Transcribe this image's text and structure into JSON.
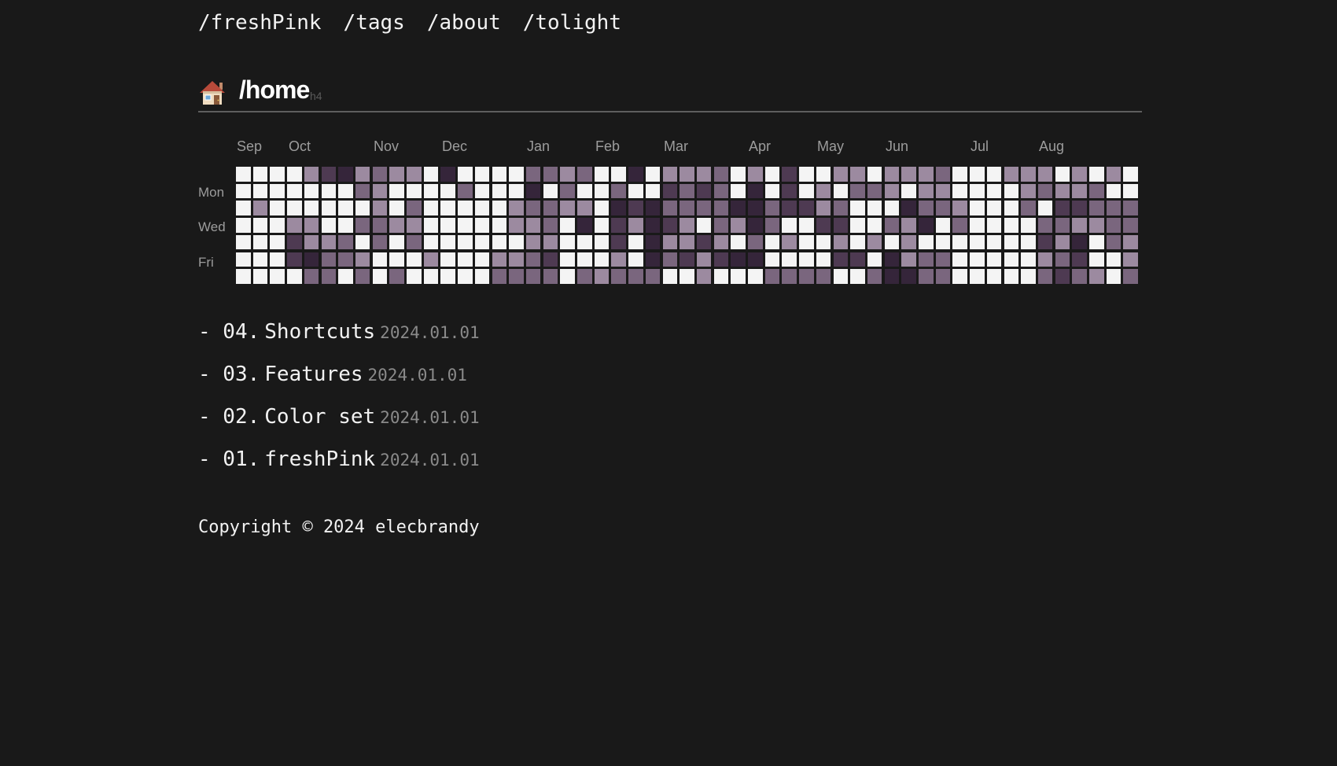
{
  "nav": {
    "items": [
      {
        "label": "/freshPink"
      },
      {
        "label": "/tags"
      },
      {
        "label": "/about"
      },
      {
        "label": "/tolight"
      }
    ]
  },
  "header": {
    "icon": "house-icon",
    "title": "/home",
    "tag": "h4"
  },
  "heatmap": {
    "months": [
      "Sep",
      "Oct",
      "Nov",
      "Dec",
      "Jan",
      "Feb",
      "Mar",
      "Apr",
      "May",
      "Jun",
      "Jul",
      "Aug"
    ],
    "day_labels": [
      "Mon",
      "Wed",
      "Fri"
    ],
    "colors": [
      "#f4f4f4",
      "#9c8aa0",
      "#7a667e",
      "#4e3a52",
      "#35253a"
    ],
    "weeks": 53,
    "levels": [
      "00001341211040000221200401112010300110111200011101010",
      "00000002100002000402002003232040301022101100001211200",
      "01000000102000001221104342222442331200042210002033222",
      "00011002211000001120403143102142003300214020000221122",
      "00031120202000000110003041131020100101010000000314021",
      "00034221000100011230001042313440000330412200000123001",
      "00002202020000022220212220010002222002442200000232102"
    ]
  },
  "posts": [
    {
      "index": "- 04.",
      "title": "Shortcuts",
      "date": "2024.01.01"
    },
    {
      "index": "- 03.",
      "title": "Features",
      "date": "2024.01.01"
    },
    {
      "index": "- 02.",
      "title": "Color set",
      "date": "2024.01.01"
    },
    {
      "index": "- 01.",
      "title": "freshPink",
      "date": "2024.01.01"
    }
  ],
  "footer": {
    "text": "Copyright © 2024 elecbrandy"
  }
}
